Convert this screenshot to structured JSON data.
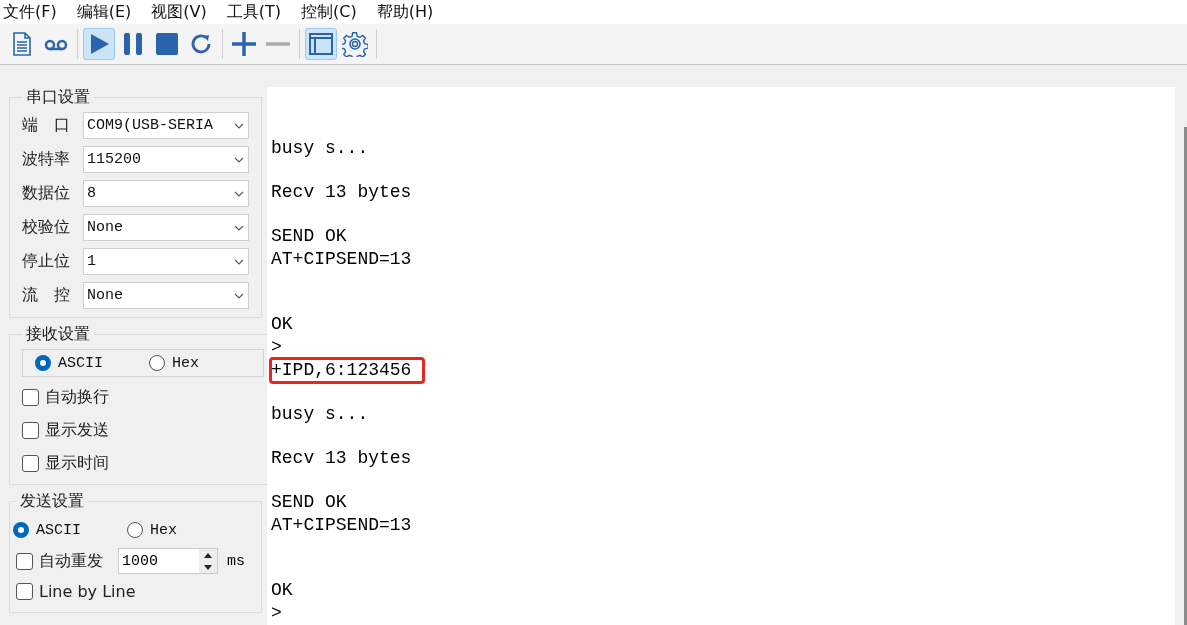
{
  "menu": [
    "文件(F)",
    "编辑(E)",
    "视图(V)",
    "工具(T)",
    "控制(C)",
    "帮助(H)"
  ],
  "toolbar": [
    {
      "kind": "document",
      "selected": false,
      "disabled": false
    },
    {
      "kind": "tape",
      "selected": false,
      "disabled": false
    },
    {
      "kind": "separator"
    },
    {
      "kind": "play",
      "selected": true,
      "disabled": false
    },
    {
      "kind": "pause",
      "selected": false,
      "disabled": false
    },
    {
      "kind": "stop",
      "selected": false,
      "disabled": false
    },
    {
      "kind": "refresh",
      "selected": false,
      "disabled": false
    },
    {
      "kind": "separator"
    },
    {
      "kind": "plus",
      "selected": false,
      "disabled": false
    },
    {
      "kind": "minus",
      "selected": false,
      "disabled": true
    },
    {
      "kind": "separator"
    },
    {
      "kind": "window",
      "selected": true,
      "disabled": false
    },
    {
      "kind": "gear",
      "selected": false,
      "disabled": false
    },
    {
      "kind": "separator"
    }
  ],
  "serial_settings": {
    "title": "串口设置",
    "fields": [
      {
        "label": "端　口",
        "value": "COM9(USB-SERIA"
      },
      {
        "label": "波特率",
        "value": "115200"
      },
      {
        "label": "数据位",
        "value": "8"
      },
      {
        "label": "校验位",
        "value": "None"
      },
      {
        "label": "停止位",
        "value": "1"
      },
      {
        "label": "流　控",
        "value": "None"
      }
    ]
  },
  "receive_settings": {
    "title": "接收设置",
    "modes": [
      {
        "label": "ASCII",
        "selected": true
      },
      {
        "label": "Hex",
        "selected": false
      }
    ],
    "options": [
      {
        "label": "自动换行",
        "checked": false
      },
      {
        "label": "显示发送",
        "checked": false
      },
      {
        "label": "显示时间",
        "checked": false
      }
    ]
  },
  "send_settings": {
    "title": "发送设置",
    "modes": [
      {
        "label": "ASCII",
        "selected": true
      },
      {
        "label": "Hex",
        "selected": false
      }
    ],
    "auto_resend": {
      "label": "自动重发",
      "checked": false,
      "value": "1000",
      "unit": "ms"
    },
    "options": [
      {
        "label": "Line by Line",
        "checked": false
      }
    ]
  },
  "log": [
    {
      "kind": "blank"
    },
    {
      "kind": "text",
      "text": "busy s...",
      "highlighted": false
    },
    {
      "kind": "blank"
    },
    {
      "kind": "text",
      "text": "Recv 13 bytes",
      "highlighted": false
    },
    {
      "kind": "blank"
    },
    {
      "kind": "text",
      "text": "SEND OK",
      "highlighted": false
    },
    {
      "kind": "text",
      "text": "AT+CIPSEND=13",
      "highlighted": false
    },
    {
      "kind": "blank"
    },
    {
      "kind": "blank"
    },
    {
      "kind": "text",
      "text": "OK",
      "highlighted": false
    },
    {
      "kind": "text",
      "text": ">",
      "highlighted": false
    },
    {
      "kind": "text",
      "text": "+IPD,6:123456",
      "highlighted": true
    },
    {
      "kind": "blank"
    },
    {
      "kind": "text",
      "text": "busy s...",
      "highlighted": false
    },
    {
      "kind": "blank"
    },
    {
      "kind": "text",
      "text": "Recv 13 bytes",
      "highlighted": false
    },
    {
      "kind": "blank"
    },
    {
      "kind": "text",
      "text": "SEND OK",
      "highlighted": false
    },
    {
      "kind": "text",
      "text": "AT+CIPSEND=13",
      "highlighted": false
    },
    {
      "kind": "blank"
    },
    {
      "kind": "blank"
    },
    {
      "kind": "text",
      "text": "OK",
      "highlighted": false
    },
    {
      "kind": "text",
      "text": ">",
      "highlighted": false
    }
  ]
}
